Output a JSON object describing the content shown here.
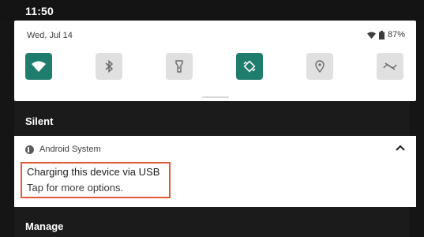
{
  "status_bar": {
    "time": "11:50"
  },
  "quick_settings": {
    "date": "Wed, Jul 14",
    "battery": "87%",
    "tiles": [
      {
        "name": "wifi",
        "icon": "wifi-icon",
        "state": "on"
      },
      {
        "name": "bluetooth",
        "icon": "bluetooth-icon",
        "state": "off"
      },
      {
        "name": "flashlight",
        "icon": "flashlight-icon",
        "state": "off"
      },
      {
        "name": "auto-rotate",
        "icon": "rotate-icon",
        "state": "on"
      },
      {
        "name": "location",
        "icon": "location-icon",
        "state": "off"
      },
      {
        "name": "data-saver",
        "icon": "data-saver-icon",
        "state": "off"
      }
    ]
  },
  "sections": {
    "silent": "Silent",
    "manage": "Manage"
  },
  "notification": {
    "app": "Android System",
    "title": "Charging this device via USB",
    "text": "Tap for more options."
  },
  "colors": {
    "tile_on": "#1f7d6e",
    "tile_off": "#e0e0e0",
    "highlight": "#e05a3a"
  }
}
